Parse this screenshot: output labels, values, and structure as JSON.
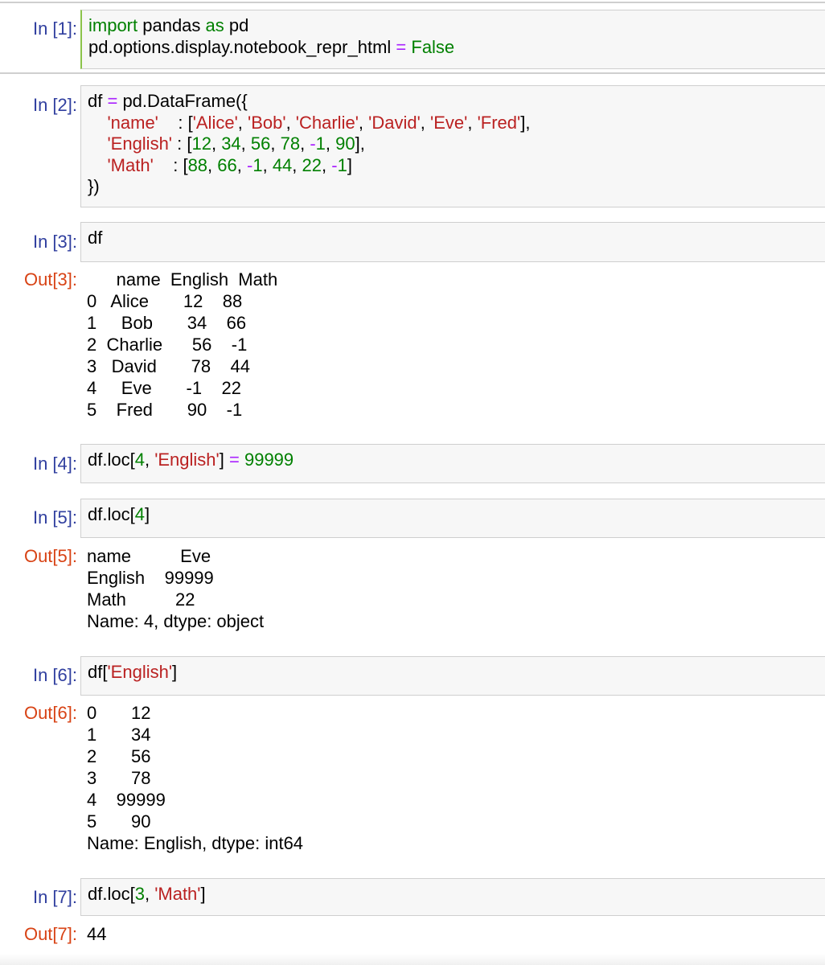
{
  "cells": [
    {
      "prompt": "In [1]:",
      "code": [
        [
          {
            "t": "import",
            "c": "kw"
          },
          {
            "t": " pandas "
          },
          {
            "t": "as",
            "c": "kw"
          },
          {
            "t": " pd"
          }
        ],
        [
          {
            "t": "pd.options.display.notebook_repr_html "
          },
          {
            "t": "=",
            "c": "op"
          },
          {
            "t": " "
          },
          {
            "t": "False",
            "c": "kw"
          }
        ]
      ]
    },
    {
      "prompt": "In [2]:",
      "code": [
        [
          {
            "t": "df "
          },
          {
            "t": "=",
            "c": "op"
          },
          {
            "t": " pd.DataFrame({"
          }
        ],
        [
          {
            "t": "    "
          },
          {
            "t": "'name'",
            "c": "str"
          },
          {
            "t": "    : ["
          },
          {
            "t": "'Alice'",
            "c": "str"
          },
          {
            "t": ", "
          },
          {
            "t": "'Bob'",
            "c": "str"
          },
          {
            "t": ", "
          },
          {
            "t": "'Charlie'",
            "c": "str"
          },
          {
            "t": ", "
          },
          {
            "t": "'David'",
            "c": "str"
          },
          {
            "t": ", "
          },
          {
            "t": "'Eve'",
            "c": "str"
          },
          {
            "t": ", "
          },
          {
            "t": "'Fred'",
            "c": "str"
          },
          {
            "t": "],"
          }
        ],
        [
          {
            "t": "    "
          },
          {
            "t": "'English'",
            "c": "str"
          },
          {
            "t": " : ["
          },
          {
            "t": "12",
            "c": "num"
          },
          {
            "t": ", "
          },
          {
            "t": "34",
            "c": "num"
          },
          {
            "t": ", "
          },
          {
            "t": "56",
            "c": "num"
          },
          {
            "t": ", "
          },
          {
            "t": "78",
            "c": "num"
          },
          {
            "t": ", "
          },
          {
            "t": "-",
            "c": "op"
          },
          {
            "t": "1",
            "c": "num"
          },
          {
            "t": ", "
          },
          {
            "t": "90",
            "c": "num"
          },
          {
            "t": "],"
          }
        ],
        [
          {
            "t": "    "
          },
          {
            "t": "'Math'",
            "c": "str"
          },
          {
            "t": "    : ["
          },
          {
            "t": "88",
            "c": "num"
          },
          {
            "t": ", "
          },
          {
            "t": "66",
            "c": "num"
          },
          {
            "t": ", "
          },
          {
            "t": "-",
            "c": "op"
          },
          {
            "t": "1",
            "c": "num"
          },
          {
            "t": ", "
          },
          {
            "t": "44",
            "c": "num"
          },
          {
            "t": ", "
          },
          {
            "t": "22",
            "c": "num"
          },
          {
            "t": ", "
          },
          {
            "t": "-",
            "c": "op"
          },
          {
            "t": "1",
            "c": "num"
          },
          {
            "t": "]"
          }
        ],
        [
          {
            "t": "})"
          }
        ]
      ]
    },
    {
      "prompt": "In [3]:",
      "code": [
        [
          {
            "t": "df"
          }
        ]
      ],
      "out_prompt": "Out[3]:",
      "output": [
        "      name  English  Math",
        "0   Alice       12    88",
        "1     Bob       34    66",
        "2  Charlie      56    -1",
        "3   David       78    44",
        "4     Eve       -1    22",
        "5    Fred       90    -1"
      ]
    },
    {
      "prompt": "In [4]:",
      "code": [
        [
          {
            "t": "df.loc["
          },
          {
            "t": "4",
            "c": "num"
          },
          {
            "t": ", "
          },
          {
            "t": "'English'",
            "c": "str"
          },
          {
            "t": "] "
          },
          {
            "t": "=",
            "c": "op"
          },
          {
            "t": " "
          },
          {
            "t": "99999",
            "c": "num"
          }
        ]
      ]
    },
    {
      "prompt": "In [5]:",
      "code": [
        [
          {
            "t": "df.loc["
          },
          {
            "t": "4",
            "c": "num"
          },
          {
            "t": "]"
          }
        ]
      ],
      "out_prompt": "Out[5]:",
      "output": [
        "name          Eve",
        "English    99999",
        "Math          22",
        "Name: 4, dtype: object"
      ]
    },
    {
      "prompt": "In [6]:",
      "code": [
        [
          {
            "t": "df["
          },
          {
            "t": "'English'",
            "c": "str"
          },
          {
            "t": "]"
          }
        ]
      ],
      "out_prompt": "Out[6]:",
      "output": [
        "0       12",
        "1       34",
        "2       56",
        "3       78",
        "4    99999",
        "5       90",
        "Name: English, dtype: int64"
      ]
    },
    {
      "prompt": "In [7]:",
      "code": [
        [
          {
            "t": "df.loc["
          },
          {
            "t": "3",
            "c": "num"
          },
          {
            "t": ", "
          },
          {
            "t": "'Math'",
            "c": "str"
          },
          {
            "t": "]"
          }
        ]
      ],
      "out_prompt": "Out[7]:",
      "output": [
        "44"
      ]
    }
  ]
}
